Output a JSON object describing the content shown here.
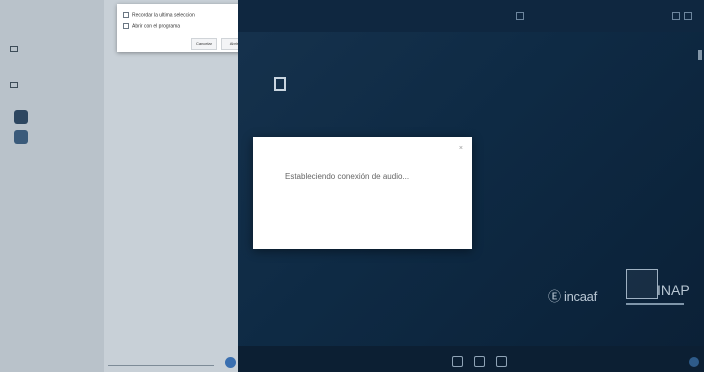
{
  "small_dialog": {
    "option_1": "Recordar la ultima seleccion",
    "option_2": "Abrir con el programa",
    "cancel_label": "Cancelar",
    "open_label": "Abrir"
  },
  "dialog": {
    "message": "Estableciendo conexión de audio...",
    "close_glyph": "×"
  },
  "logos": {
    "left": "Ⓔ incaaf",
    "right": "INAP"
  },
  "colors": {
    "video_bg": "#0e2a44",
    "left_panel": "#c4ccd3",
    "accent": "#3a6fb0"
  }
}
